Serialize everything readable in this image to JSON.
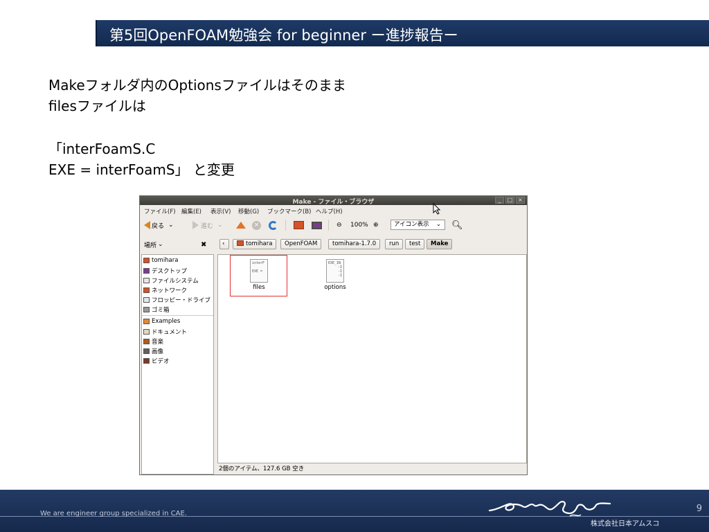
{
  "slide": {
    "title": "第5回OpenFOAM勉強会 for beginner  ー進捗報告ー",
    "lines": [
      "Makeフォルダ内のOptionsファイルはそのまま",
      "filesファイルは",
      "「interFoamS.C",
      "EXE = interFoamS」 と変更"
    ]
  },
  "window": {
    "title": "Make - ファイル・ブラウザ",
    "buttons": {
      "minimize": "_",
      "maximize": "□",
      "close": "×"
    },
    "menu": [
      "ファイル(F)",
      "編集(E)",
      "表示(V)",
      "移動(G)",
      "ブックマーク(B)",
      "ヘルプ(H)"
    ],
    "toolbar": {
      "back": "戻る",
      "forward": "進む",
      "zoom": "100%",
      "view_mode": "アイコン表示"
    },
    "places_label": "場所",
    "breadcrumbs": [
      "tomihara",
      "OpenFOAM",
      "tomihara-1.7.0",
      "run",
      "test",
      "Make"
    ],
    "sidebar": [
      {
        "label": "tomihara",
        "icon": "home-folder-icon",
        "color": "#d2542a"
      },
      {
        "label": "デスクトップ",
        "icon": "desktop-icon",
        "color": "#7a3c8e"
      },
      {
        "label": "ファイルシステム",
        "icon": "drive-icon",
        "color": "#cfcfcf"
      },
      {
        "label": "ネットワーク",
        "icon": "network-icon",
        "color": "#d2542a"
      },
      {
        "label": "フロッピー・ドライブ",
        "icon": "floppy-icon",
        "color": "#cfcfcf"
      },
      {
        "label": "ゴミ箱",
        "icon": "trash-icon",
        "color": "#9a9a9a"
      },
      {
        "label": "Examples",
        "icon": "folder-icon",
        "color": "#e08a3a"
      },
      {
        "label": "ドキュメント",
        "icon": "documents-icon",
        "color": "#e0d8c0"
      },
      {
        "label": "音楽",
        "icon": "music-icon",
        "color": "#b05a20"
      },
      {
        "label": "画像",
        "icon": "pictures-icon",
        "color": "#606060"
      },
      {
        "label": "ビデオ",
        "icon": "video-icon",
        "color": "#7a3a2a"
      }
    ],
    "files": [
      {
        "name": "files",
        "preview": [
          "interF",
          "",
          "EXE ="
        ]
      },
      {
        "name": "options",
        "preview": [
          "EXE_IN",
          "-I",
          "-I",
          "-I"
        ]
      }
    ],
    "status": "2個のアイテム、127.6 GB 空き"
  },
  "footer": {
    "tagline": "We are engineer group specialized in CAE.",
    "page": "9",
    "company": "株式会社日本アムスコ"
  },
  "colors": {
    "header_bg": "#1b355f",
    "footer_bg": "#1d3359",
    "selection_border": "#e03030"
  }
}
